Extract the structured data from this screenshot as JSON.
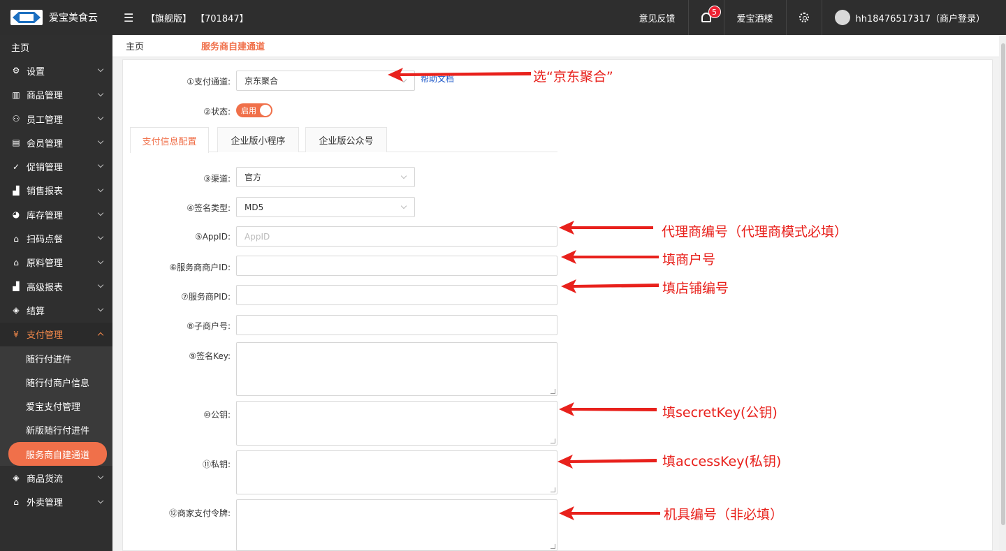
{
  "app": {
    "name": "爱宝美食云",
    "edition": "【旗舰版】",
    "store_id": "【701847】"
  },
  "header": {
    "feedback": "意见反馈",
    "notification_count": "5",
    "store_name": "爱宝酒楼",
    "user": "hh18476517317（商户登录）"
  },
  "sidebar": {
    "home": "主页",
    "items": [
      {
        "label": "设置",
        "icon": "gear-icon"
      },
      {
        "label": "商品管理",
        "icon": "barcode-icon"
      },
      {
        "label": "员工管理",
        "icon": "people-icon"
      },
      {
        "label": "会员管理",
        "icon": "member-card-icon"
      },
      {
        "label": "促销管理",
        "icon": "check-circle-icon"
      },
      {
        "label": "销售报表",
        "icon": "bar-chart-icon"
      },
      {
        "label": "库存管理",
        "icon": "pie-chart-icon"
      },
      {
        "label": "扫码点餐",
        "icon": "shop-icon"
      },
      {
        "label": "原料管理",
        "icon": "shop-icon"
      },
      {
        "label": "高级报表",
        "icon": "bar-chart-icon"
      },
      {
        "label": "结算",
        "icon": "cube-icon"
      }
    ],
    "open_group": {
      "label": "支付管理",
      "icon": "yen-icon"
    },
    "sub_items": [
      "随行付进件",
      "随行付商户信息",
      "爱宝支付管理",
      "新版随行付进件",
      "服务商自建通道"
    ],
    "after_items": [
      {
        "label": "商品货流",
        "icon": "cube-icon"
      },
      {
        "label": "外卖管理",
        "icon": "shop-icon"
      }
    ]
  },
  "breadcrumb": {
    "home": "主页",
    "current": "服务商自建通道"
  },
  "form": {
    "channel_label": "①支付通道:",
    "channel_value": "京东聚合",
    "help_link": "帮助文档",
    "status_label": "②状态:",
    "status_value": "启用",
    "tabs": [
      "支付信息配置",
      "企业版小程序",
      "企业版公众号"
    ],
    "route_label": "③渠道:",
    "route_value": "官方",
    "sign_type_label": "④签名类型:",
    "sign_type_value": "MD5",
    "appid_label": "⑤AppID:",
    "appid_placeholder": "AppID",
    "merchant_id_label": "⑥服务商商户ID:",
    "pid_label": "⑦服务商PID:",
    "sub_merchant_label": "⑧子商户号:",
    "sign_key_label": "⑨签名Key:",
    "public_key_label": "⑩公钥:",
    "private_key_label": "⑪私钥:",
    "token_label": "⑫商家支付令牌:"
  },
  "annotations": {
    "channel": "选“京东聚合”",
    "appid": "代理商编号（代理商模式必填）",
    "merchant_id": "填商户号",
    "pid": "填店铺编号",
    "public_key": "填secretKey(公钥)",
    "private_key": "填accessKey(私钥)",
    "token": "机具编号（非必填）",
    "color": "#e8211c"
  },
  "colors": {
    "accent": "#f0704a",
    "topbar": "#2e2e2e",
    "sidebar": "#2f2f2f"
  }
}
